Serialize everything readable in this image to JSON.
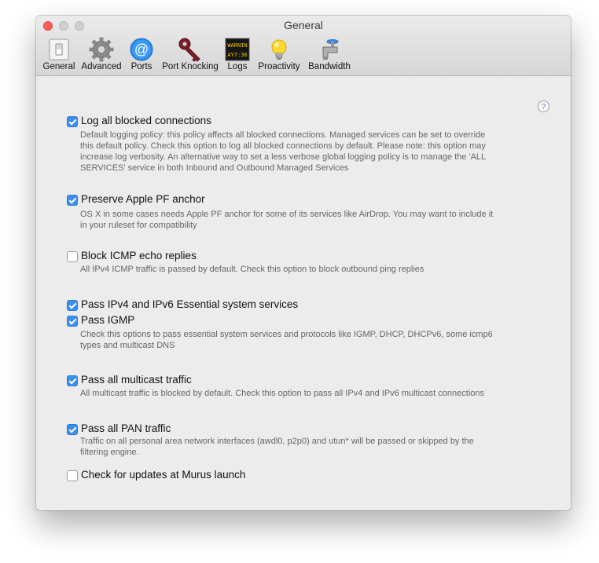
{
  "window": {
    "title": "General"
  },
  "toolbar": [
    {
      "label": "General",
      "icon": "switch-icon"
    },
    {
      "label": "Advanced",
      "icon": "gear-icon"
    },
    {
      "label": "Ports",
      "icon": "at-icon"
    },
    {
      "label": "Port Knocking",
      "icon": "key-icon"
    },
    {
      "label": "Logs",
      "icon": "led-display-icon",
      "display_text": [
        "WARNIN",
        "AY7:36"
      ]
    },
    {
      "label": "Proactivity",
      "icon": "lightbulb-icon"
    },
    {
      "label": "Bandwidth",
      "icon": "faucet-icon"
    }
  ],
  "help": {
    "glyph": "?"
  },
  "options": [
    {
      "label": "Log all blocked connections",
      "checked": true,
      "description": [
        "Default logging policy: this policy affects all blocked connections. Managed services can be set to override",
        "this default policy. Check this option to log all blocked connections by default. Please note: this option may",
        "increase log verbosity. An alternative way to set a less verbose global logging policy is to manage the 'ALL",
        "SERVICES' service in both Inbound and Outbound Managed Services"
      ]
    },
    {
      "label": "Preserve Apple PF anchor",
      "checked": true,
      "description": [
        "OS X in some cases needs Apple PF anchor for some of its services like AirDrop. You may want to include it",
        "in your ruleset for compatibility"
      ]
    },
    {
      "label": "Block ICMP echo replies",
      "checked": false,
      "description": [
        "All IPv4 ICMP traffic is passed by default. Check this option to block outbound ping replies"
      ]
    },
    {
      "label": "Pass IPv4 and IPv6 Essential system services",
      "checked": true,
      "description": []
    },
    {
      "label": "Pass IGMP",
      "checked": true,
      "description": [
        "Check this options to pass essential system services and protocols like IGMP, DHCP, DHCPv6, some icmp6",
        "types and multicast DNS"
      ]
    },
    {
      "label": "Pass all multicast traffic",
      "checked": true,
      "description": [
        "All multicast traffic is blocked by default. Check this option to pass all IPv4 and IPv6 multicast connections"
      ]
    },
    {
      "label": "Pass all PAN traffic",
      "checked": true,
      "description": [
        "Traffic on all personal area network interfaces (awdl0, p2p0) and utun* will be passed or skipped by the",
        "filtering engine."
      ]
    },
    {
      "label": "Check for updates at Murus launch",
      "checked": false,
      "description": []
    }
  ]
}
